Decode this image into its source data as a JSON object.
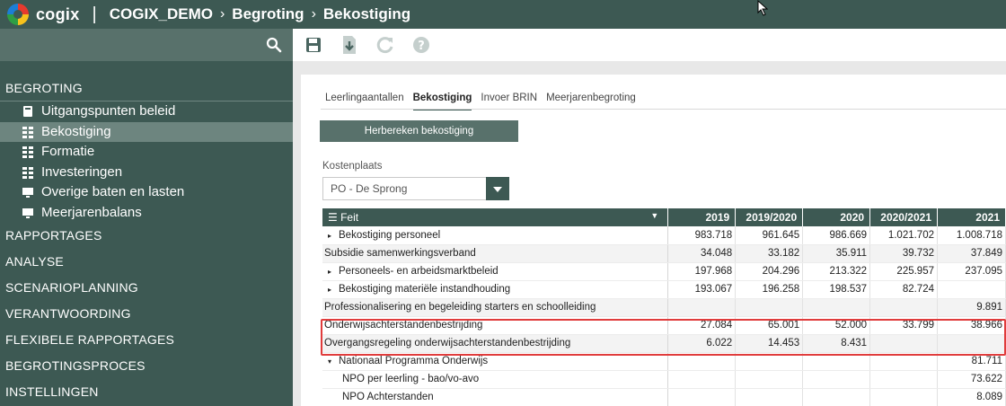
{
  "header": {
    "app_name": "cogix",
    "separator": "|",
    "breadcrumb": [
      "COGIX_DEMO",
      "Begroting",
      "Bekostiging"
    ],
    "crumb_sep": "›"
  },
  "sidebar": {
    "sections": [
      {
        "label": "BEGROTING",
        "open": true,
        "items": [
          {
            "label": "Uitgangspunten beleid",
            "icon": "book-icon"
          },
          {
            "label": "Bekostiging",
            "icon": "grid-icon",
            "active": true
          },
          {
            "label": "Formatie",
            "icon": "grid-icon"
          },
          {
            "label": "Investeringen",
            "icon": "grid-icon"
          },
          {
            "label": "Overige baten en lasten",
            "icon": "monitor-icon"
          },
          {
            "label": "Meerjarenbalans",
            "icon": "monitor-icon"
          }
        ]
      },
      {
        "label": "RAPPORTAGES"
      },
      {
        "label": "ANALYSE"
      },
      {
        "label": "SCENARIOPLANNING"
      },
      {
        "label": "VERANTWOORDING"
      },
      {
        "label": "FLEXIBELE RAPPORTAGES"
      },
      {
        "label": "BEGROTINGSPROCES"
      },
      {
        "label": "INSTELLINGEN"
      }
    ]
  },
  "toolbar": {
    "icons": [
      "save-icon",
      "download-icon",
      "refresh-icon",
      "help-icon"
    ]
  },
  "tabs": [
    "Leerlingaantallen",
    "Bekostiging",
    "Invoer BRIN",
    "Meerjarenbegroting"
  ],
  "active_tab": "Bekostiging",
  "recalc_button": "Herbereken bekostiging",
  "kostenplaats": {
    "label": "Kostenplaats",
    "value": "PO - De Sprong"
  },
  "table": {
    "feit_header": "☰ Feit",
    "columns": [
      "2019",
      "2019/2020",
      "2020",
      "2020/2021",
      "2021"
    ],
    "rows": [
      {
        "name": "Bekostiging personeel",
        "caret": "▸",
        "indent": 1,
        "values": [
          "983.718",
          "961.645",
          "986.669",
          "1.021.702",
          "1.008.718"
        ]
      },
      {
        "name": "Subsidie samenwerkingsverband",
        "caret": "",
        "indent": 0,
        "values": [
          "34.048",
          "33.182",
          "35.911",
          "39.732",
          "37.849"
        ]
      },
      {
        "name": "Personeels- en arbeidsmarktbeleid",
        "caret": "▸",
        "indent": 1,
        "values": [
          "197.968",
          "204.296",
          "213.322",
          "225.957",
          "237.095"
        ]
      },
      {
        "name": "Bekostiging materiële instandhouding",
        "caret": "▸",
        "indent": 1,
        "values": [
          "193.067",
          "196.258",
          "198.537",
          "82.724",
          ""
        ]
      },
      {
        "name": "Professionalisering en begeleiding starters en schoolleiding",
        "caret": "",
        "indent": 0,
        "values": [
          "",
          "",
          "",
          "",
          "9.891"
        ]
      },
      {
        "name": "Onderwijsachterstandenbestrijding",
        "caret": "",
        "indent": 0,
        "values": [
          "27.084",
          "65.001",
          "52.000",
          "33.799",
          "38.966"
        ]
      },
      {
        "name": "Overgangsregeling onderwijsachterstandenbestrijding",
        "caret": "",
        "indent": 0,
        "values": [
          "6.022",
          "14.453",
          "8.431",
          "",
          ""
        ]
      },
      {
        "name": "Nationaal Programma Onderwijs",
        "caret": "▾",
        "indent": 1,
        "values": [
          "",
          "",
          "",
          "",
          "81.711"
        ]
      },
      {
        "name": "NPO per leerling - bao/vo-avo",
        "caret": "",
        "indent": 2,
        "values": [
          "",
          "",
          "",
          "",
          "73.622"
        ]
      },
      {
        "name": "NPO Achterstanden",
        "caret": "",
        "indent": 2,
        "values": [
          "",
          "",
          "",
          "",
          "8.089"
        ]
      }
    ]
  }
}
